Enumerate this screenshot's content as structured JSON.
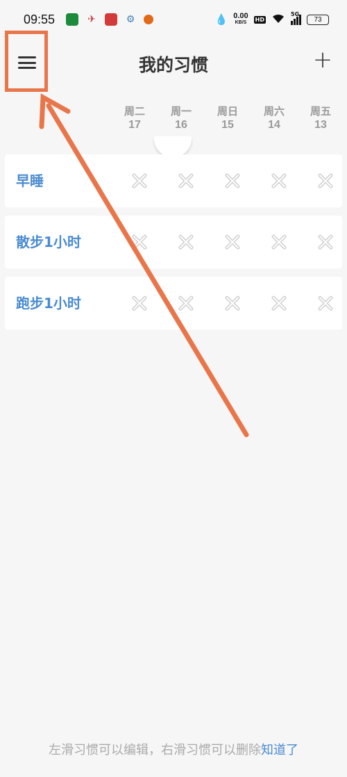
{
  "status_bar": {
    "time": "09:55",
    "net_speed_value": "0.00",
    "net_speed_unit": "KB/S",
    "hd": "HD",
    "signal": "5G",
    "battery": "73",
    "notification_icons": [
      "app-green-icon",
      "app-runner-icon",
      "app-red-icon",
      "app-tool-icon",
      "app-orange-icon"
    ],
    "notification_colors": [
      "#1e8a3c",
      "#c23c3c",
      "#d33a3a",
      "#4a7fb5",
      "#e06a1a"
    ]
  },
  "header": {
    "title": "我的习惯",
    "add_label": "+",
    "menu_icon": "hamburger-menu-icon"
  },
  "days": [
    {
      "weekday": "周二",
      "date": "17"
    },
    {
      "weekday": "周一",
      "date": "16"
    },
    {
      "weekday": "周日",
      "date": "15"
    },
    {
      "weekday": "周六",
      "date": "14"
    },
    {
      "weekday": "周五",
      "date": "13"
    }
  ],
  "habits": [
    {
      "name": "早睡",
      "marks": [
        "x",
        "x",
        "x",
        "x",
        "x"
      ]
    },
    {
      "name": "散步1小时",
      "marks": [
        "x",
        "x",
        "x",
        "x",
        "x"
      ]
    },
    {
      "name": "跑步1小时",
      "marks": [
        "x",
        "x",
        "x",
        "x",
        "x"
      ]
    }
  ],
  "footer": {
    "hint": "左滑习惯可以编辑，右滑习惯可以删除",
    "link": "知道了"
  },
  "colors": {
    "accent": "#4a8bd0",
    "annotation": "#e8764a",
    "mark": "#cfcfcf",
    "background": "#f6f6f6"
  }
}
